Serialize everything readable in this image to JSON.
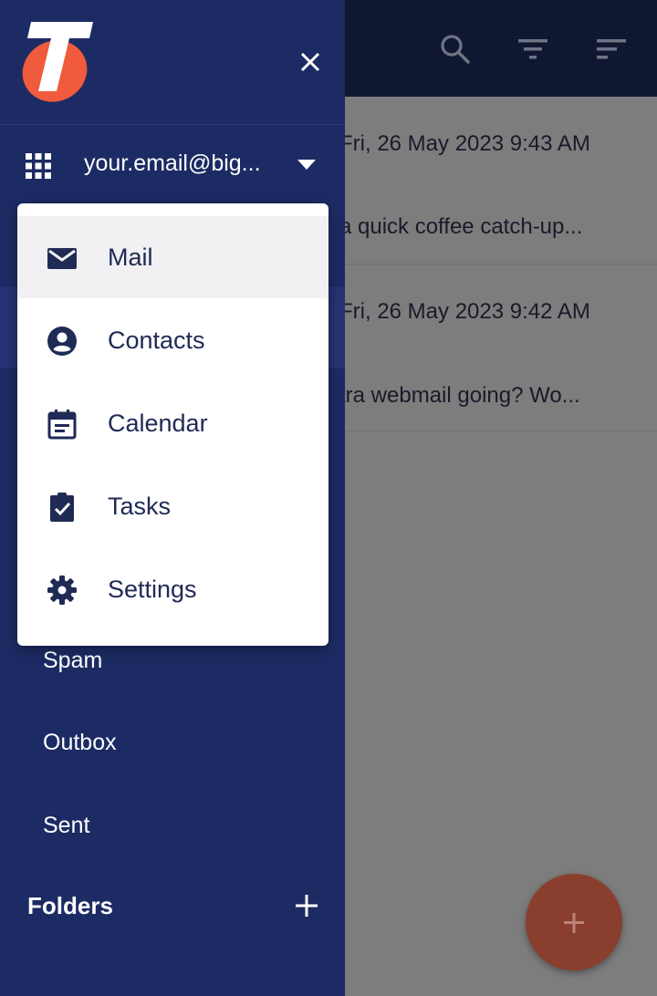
{
  "colors": {
    "drawer_bg": "#1c2b63",
    "topbar_bg": "#0f1830",
    "accent": "#ef5b3c",
    "menu_text": "#1f2a55"
  },
  "account": {
    "email": "your.email@big..."
  },
  "messages": [
    {
      "date": "Fri, 26 May 2023 9:43 AM",
      "snippet": "a quick coffee catch-up..."
    },
    {
      "date": "Fri, 26 May 2023 9:42 AM",
      "snippet": "tra webmail going? Wo..."
    }
  ],
  "menu": {
    "items": [
      {
        "label": "Mail",
        "icon": "mail-icon"
      },
      {
        "label": "Contacts",
        "icon": "contacts-icon"
      },
      {
        "label": "Calendar",
        "icon": "calendar-icon"
      },
      {
        "label": "Tasks",
        "icon": "tasks-icon"
      },
      {
        "label": "Settings",
        "icon": "settings-icon"
      }
    ]
  },
  "nav": {
    "spam": "Spam",
    "outbox": "Outbox",
    "sent": "Sent",
    "folders": "Folders"
  },
  "icons": {
    "search": "search-icon",
    "filter": "filter-icon",
    "sort": "sort-icon",
    "close": "close-icon",
    "apps": "apps-grid-icon",
    "dropdown": "caret-down-icon",
    "add_folder": "plus-icon",
    "compose": "plus-icon",
    "logo": "telstra-logo"
  }
}
